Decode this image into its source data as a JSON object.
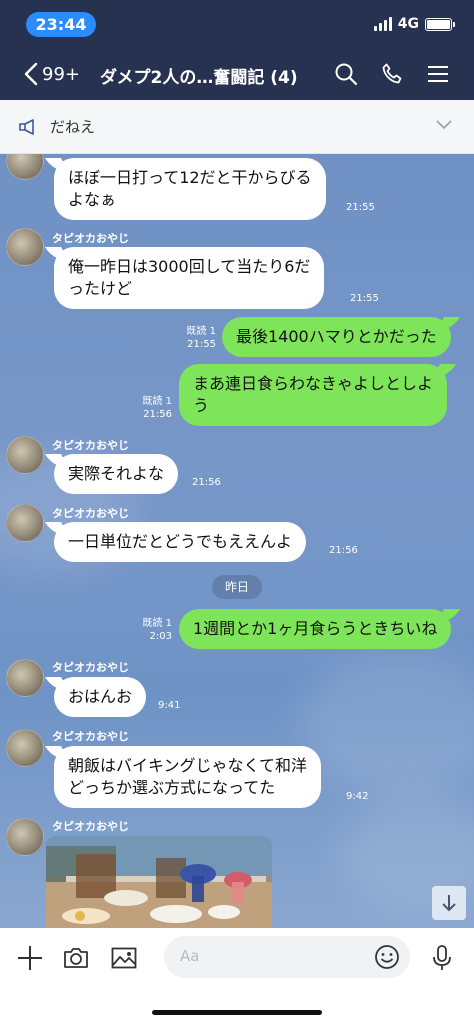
{
  "status": {
    "time": "23:44",
    "network": "4G"
  },
  "nav": {
    "back_count": "99+",
    "title": "ダメプ2人の…奮闘記 (4)"
  },
  "announcement": {
    "text": "だねえ"
  },
  "messages": [
    {
      "type": "in",
      "lines": [
        "ほぼ一日打って12だと干からびる",
        "よなぁ"
      ],
      "time": "21:55"
    },
    {
      "type": "in",
      "sender": "タピオカおやじ",
      "lines": [
        "俺一昨日は3000回して当たり6だ",
        "ったけど"
      ],
      "time": "21:55"
    },
    {
      "type": "out",
      "read": "既読 1",
      "time": "21:55",
      "lines": [
        "最後1400ハマりとかだった"
      ]
    },
    {
      "type": "out",
      "read": "既読 1",
      "time": "21:56",
      "lines": [
        "まあ連日食らわなきゃよしとしよ",
        "う"
      ]
    },
    {
      "type": "in",
      "sender": "タピオカおやじ",
      "lines": [
        "実際それよな"
      ],
      "time": "21:56"
    },
    {
      "type": "in",
      "sender": "タピオカおやじ",
      "lines": [
        "一日単位だとどうでもええんよ"
      ],
      "time": "21:56"
    },
    {
      "type": "date",
      "label": "昨日"
    },
    {
      "type": "out",
      "read": "既読 1",
      "time": "2:03",
      "lines": [
        "1週間とか1ヶ月食らうときちいね"
      ]
    },
    {
      "type": "in",
      "sender": "タピオカおやじ",
      "lines": [
        "おはんお"
      ],
      "time": "9:41"
    },
    {
      "type": "in",
      "sender": "タピオカおやじ",
      "lines": [
        "朝飯はバイキングじゃなくて和洋",
        "どっちか選ぶ方式になってた"
      ],
      "time": "9:42"
    },
    {
      "type": "photo",
      "sender": "タピオカおやじ"
    }
  ],
  "input": {
    "placeholder": "Aa"
  },
  "icons": {
    "back": "chevron-left-icon",
    "search": "search-icon",
    "call": "phone-icon",
    "menu": "menu-icon",
    "announce": "megaphone-icon",
    "expand": "chevron-down-icon",
    "plus": "plus-icon",
    "camera": "camera-icon",
    "image": "image-icon",
    "emoji": "emoji-icon",
    "mic": "mic-icon",
    "scroll": "arrow-down-icon"
  },
  "colors": {
    "header": "#263250",
    "chat_bg": "#7394c7",
    "outgoing": "#7ee55a",
    "incoming": "#ffffff",
    "time_pill": "#2a8cff"
  }
}
